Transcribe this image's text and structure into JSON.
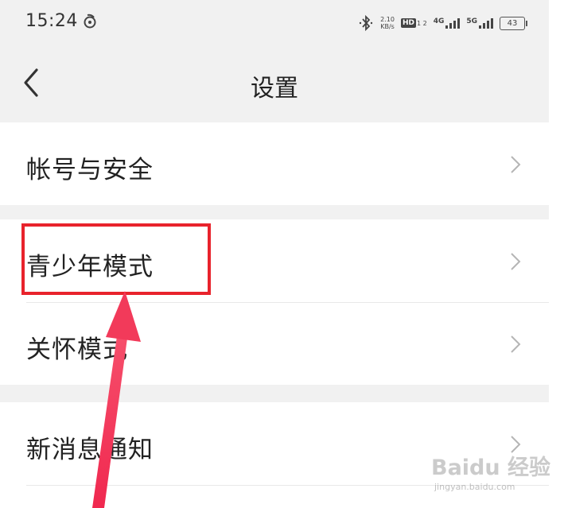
{
  "status_bar": {
    "time": "15:24",
    "app_icon": "weibo-logo-icon",
    "bluetooth_icon": "bluetooth-icon",
    "net_speed_value": "2.10",
    "net_speed_unit": "KB/s",
    "hd_label": "HD",
    "hd_sub": "1 2",
    "signal_1_label": "4G",
    "signal_2_label": "5G",
    "battery_level": "43"
  },
  "header": {
    "back_icon": "chevron-left-icon",
    "title": "设置"
  },
  "settings": {
    "account_security": "帐号与安全",
    "youth_mode": "青少年模式",
    "care_mode": "关怀模式",
    "new_message_notification": "新消息通知"
  },
  "annotation": {
    "highlight_color": "#e8232c",
    "arrow_color": "#f23a5a"
  },
  "watermark": {
    "main": "Baidu 经验",
    "sub": "jingyan.baidu.com"
  }
}
